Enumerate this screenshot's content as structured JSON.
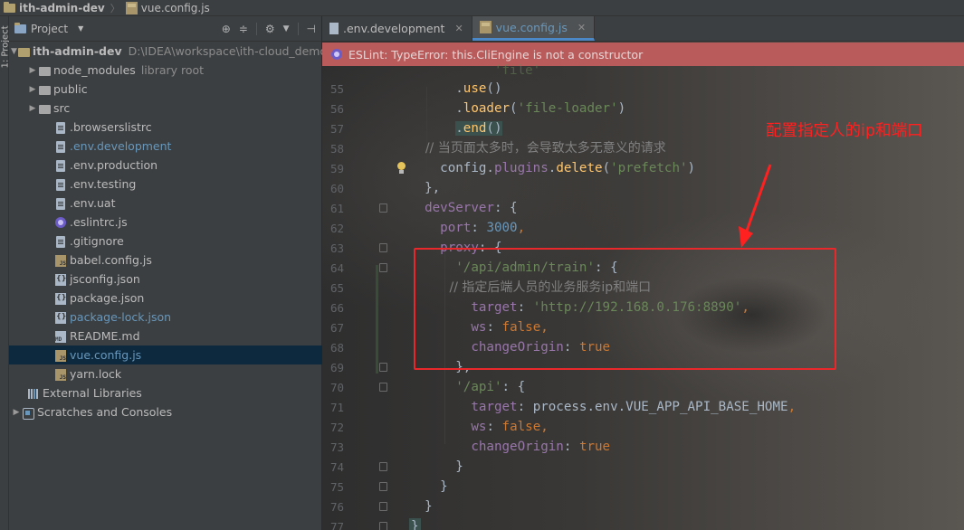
{
  "navbar": {
    "project": "ith-admin-dev",
    "file": "vue.config.js"
  },
  "toolstrip": {
    "label": "1: Project"
  },
  "project_panel": {
    "title": "Project",
    "items": [
      {
        "name": "ith-admin-dev",
        "path": "D:\\IDEA\\workspace\\ith-cloud_demo\\",
        "kind": "root",
        "indent": 0
      },
      {
        "name": "node_modules",
        "lib": "library root",
        "kind": "folder",
        "indent": 1
      },
      {
        "name": "public",
        "kind": "folder",
        "indent": 1
      },
      {
        "name": "src",
        "kind": "folder",
        "indent": 1
      },
      {
        "name": ".browserslistrc",
        "kind": "file",
        "indent": 2
      },
      {
        "name": ".env.development",
        "kind": "file",
        "indent": 2,
        "blue": true
      },
      {
        "name": ".env.production",
        "kind": "file",
        "indent": 2
      },
      {
        "name": ".env.testing",
        "kind": "file",
        "indent": 2
      },
      {
        "name": ".env.uat",
        "kind": "file",
        "indent": 2
      },
      {
        "name": ".eslintrc.js",
        "kind": "eslint",
        "indent": 2
      },
      {
        "name": ".gitignore",
        "kind": "file",
        "indent": 2
      },
      {
        "name": "babel.config.js",
        "kind": "js",
        "indent": 2
      },
      {
        "name": "jsconfig.json",
        "kind": "json",
        "indent": 2
      },
      {
        "name": "package.json",
        "kind": "json",
        "indent": 2
      },
      {
        "name": "package-lock.json",
        "kind": "json",
        "indent": 2,
        "blue": true
      },
      {
        "name": "README.md",
        "kind": "md",
        "indent": 2
      },
      {
        "name": "vue.config.js",
        "kind": "js",
        "indent": 2,
        "blue": true,
        "selected": true
      },
      {
        "name": "yarn.lock",
        "kind": "js",
        "indent": 2
      },
      {
        "name": "External Libraries",
        "kind": "lib",
        "indent": 0,
        "noarrow": true
      },
      {
        "name": "Scratches and Consoles",
        "kind": "scratch",
        "indent": 0
      }
    ]
  },
  "tabs": [
    {
      "name": ".env.development",
      "active": false
    },
    {
      "name": "vue.config.js",
      "active": true
    }
  ],
  "banner": {
    "text": "ESLint: TypeError: this.CliEngine is not a constructor"
  },
  "line_numbers": [
    "55",
    "56",
    "57",
    "58",
    "59",
    "60",
    "61",
    "62",
    "63",
    "64",
    "65",
    "66",
    "67",
    "68",
    "69",
    "70",
    "71",
    "72",
    "73",
    "74",
    "75",
    "76",
    "77"
  ],
  "code": {
    "l55": [
      ".",
      "use",
      "()"
    ],
    "l56": [
      ".",
      "loader",
      "(",
      "'file-loader'",
      ")"
    ],
    "l57": [
      ".",
      "end",
      "()"
    ],
    "l58": "// 当页面太多时，会导致太多无意义的请求",
    "l59": [
      "config",
      ".",
      "plugins",
      ".",
      "delete",
      "(",
      "'prefetch'",
      ")"
    ],
    "l60": "},",
    "l61": [
      "devServer",
      ": {"
    ],
    "l62": [
      "port",
      ": ",
      "3000",
      ","
    ],
    "l63": [
      "proxy",
      ": {"
    ],
    "l64": [
      "'/api/admin/train'",
      ": {"
    ],
    "l65": "// 指定后端人员的业务服务ip和端口",
    "l66": [
      "target",
      ": ",
      "'http://192.168.0.176:8890'",
      ","
    ],
    "l67": [
      "ws",
      ": ",
      "false",
      ","
    ],
    "l68": [
      "changeOrigin",
      ": ",
      "true"
    ],
    "l69": "},",
    "l70": [
      "'/api'",
      ": {"
    ],
    "l71": [
      "target",
      ": ",
      "process.env.VUE_APP_API_BASE_HOME",
      ","
    ],
    "l72": [
      "ws",
      ": ",
      "false",
      ","
    ],
    "l73": [
      "changeOrigin",
      ": ",
      "true"
    ],
    "l74": "}",
    "l75": "}",
    "l76": "}",
    "l77": "}"
  },
  "annotation": {
    "text": "配置指定人的ip和端口"
  },
  "colors": {
    "keyword": "#cc7832",
    "string": "#6a8759",
    "method": "#ffc66d",
    "comment": "#808080",
    "property": "#9876aa",
    "number": "#6897bb",
    "annotation": "#ff2020"
  }
}
